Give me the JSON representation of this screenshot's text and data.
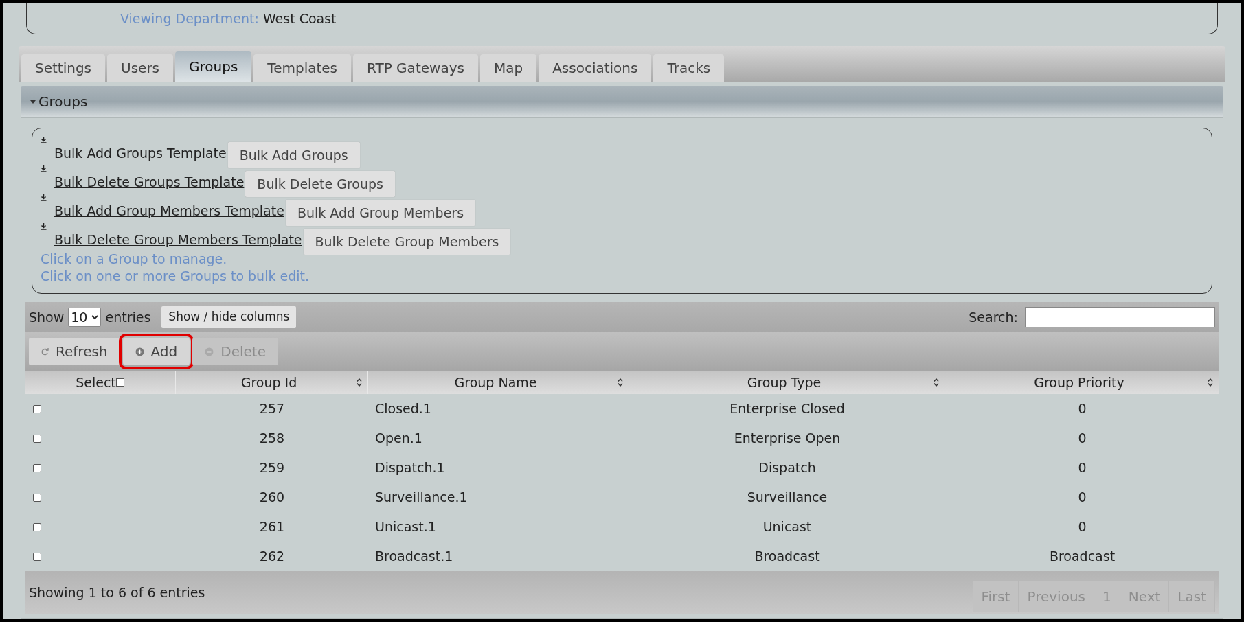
{
  "department": {
    "label": "Viewing Department:",
    "value": "West Coast"
  },
  "tabs": [
    {
      "label": "Settings",
      "selected": false
    },
    {
      "label": "Users",
      "selected": false
    },
    {
      "label": "Groups",
      "selected": true
    },
    {
      "label": "Templates",
      "selected": false
    },
    {
      "label": "RTP Gateways",
      "selected": false
    },
    {
      "label": "Map",
      "selected": false
    },
    {
      "label": "Associations",
      "selected": false
    },
    {
      "label": "Tracks",
      "selected": false
    }
  ],
  "section": {
    "title": "Groups",
    "expanded": true
  },
  "bulk_actions": [
    {
      "template": "Bulk Add Groups Template",
      "button": "Bulk Add Groups"
    },
    {
      "template": "Bulk Delete Groups Template",
      "button": "Bulk Delete Groups"
    },
    {
      "template": "Bulk Add Group Members Template",
      "button": "Bulk Add Group Members"
    },
    {
      "template": "Bulk Delete Group Members Template",
      "button": "Bulk Delete Group Members"
    }
  ],
  "hints": [
    "Click on a Group to manage.",
    "Click on one or more Groups to bulk edit."
  ],
  "length": {
    "before": "Show",
    "value": "10",
    "after": "entries"
  },
  "columns_button": "Show / hide columns",
  "search": {
    "label": "Search:"
  },
  "toolbar": [
    {
      "label": "Refresh",
      "kind": "refresh",
      "disabled": false,
      "highlighted": false
    },
    {
      "label": "Add",
      "kind": "add",
      "disabled": false,
      "highlighted": true
    },
    {
      "label": "Delete",
      "kind": "delete",
      "disabled": true,
      "highlighted": false
    }
  ],
  "table": {
    "select_column": "Select",
    "columns": [
      "Group Id",
      "Group Name",
      "Group Type",
      "Group Priority"
    ],
    "select_all": false,
    "rows": [
      {
        "checked": false,
        "cells": [
          "257",
          "Closed.1",
          "Enterprise Closed",
          "0"
        ]
      },
      {
        "checked": false,
        "cells": [
          "258",
          "Open.1",
          "Enterprise Open",
          "0"
        ]
      },
      {
        "checked": false,
        "cells": [
          "259",
          "Dispatch.1",
          "Dispatch",
          "0"
        ]
      },
      {
        "checked": false,
        "cells": [
          "260",
          "Surveillance.1",
          "Surveillance",
          "0"
        ]
      },
      {
        "checked": false,
        "cells": [
          "261",
          "Unicast.1",
          "Unicast",
          "0"
        ]
      },
      {
        "checked": false,
        "cells": [
          "262",
          "Broadcast.1",
          "Broadcast",
          "Broadcast"
        ]
      }
    ]
  },
  "info": "Showing 1 to 6 of 6 entries",
  "pagination": [
    {
      "label": "First",
      "disabled": true
    },
    {
      "label": "Previous",
      "disabled": true
    },
    {
      "label": "1",
      "disabled": true
    },
    {
      "label": "Next",
      "disabled": true
    },
    {
      "label": "Last",
      "disabled": true
    }
  ]
}
